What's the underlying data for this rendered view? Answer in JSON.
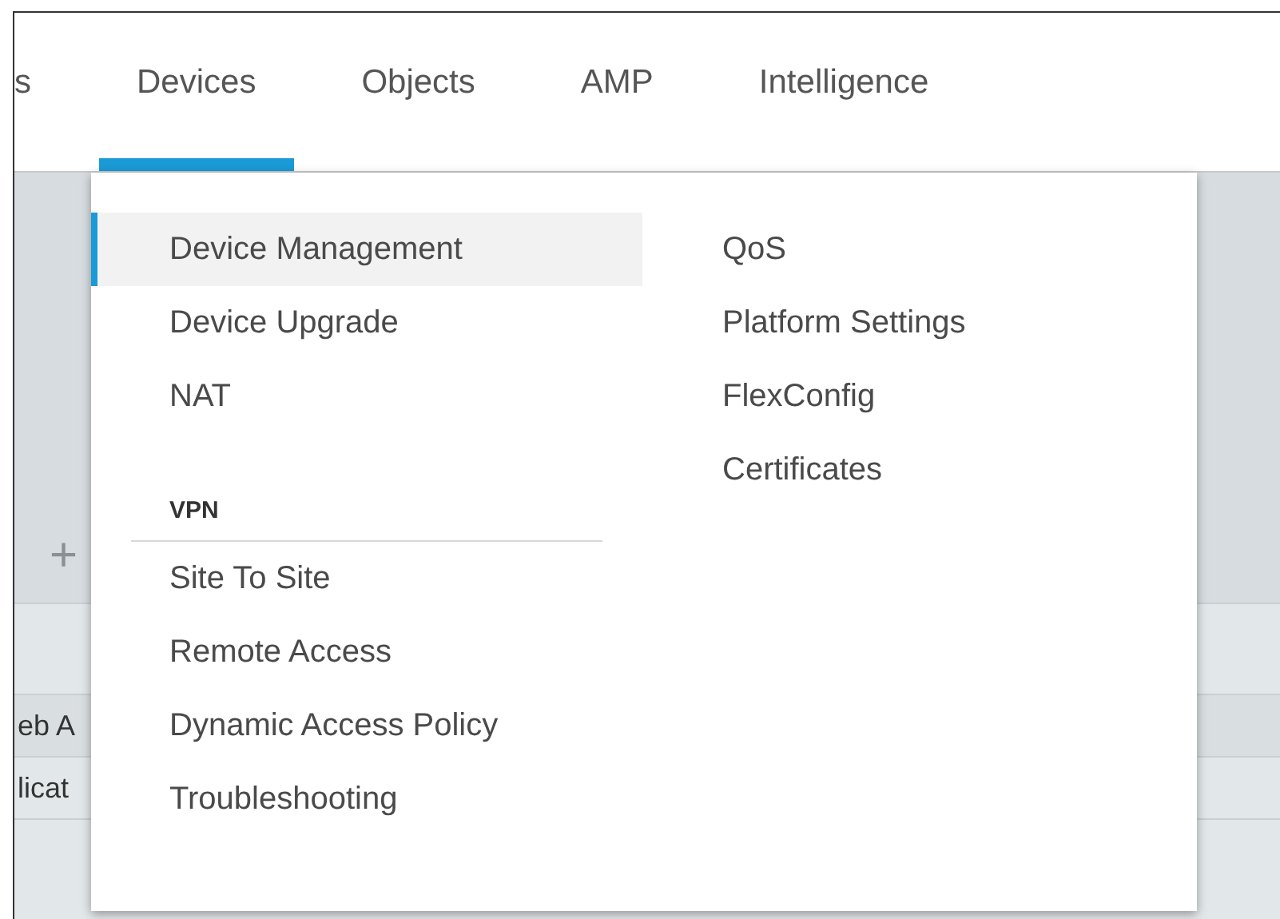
{
  "nav": {
    "tabs": [
      {
        "label": "s",
        "selected": false
      },
      {
        "label": "Devices",
        "selected": true
      },
      {
        "label": "Objects",
        "selected": false
      },
      {
        "label": "AMP",
        "selected": false
      },
      {
        "label": "Intelligence",
        "selected": false
      }
    ]
  },
  "background": {
    "add_icon": "+",
    "rows": [
      "eb A",
      "licat"
    ]
  },
  "menu": {
    "columns": [
      {
        "sections": [
          {
            "items": [
              {
                "label": "Device Management",
                "selected": true
              },
              {
                "label": "Device Upgrade",
                "selected": false
              },
              {
                "label": "NAT",
                "selected": false
              }
            ]
          },
          {
            "header": "VPN",
            "items": [
              {
                "label": "Site To Site",
                "selected": false
              },
              {
                "label": "Remote Access",
                "selected": false
              },
              {
                "label": "Dynamic Access Policy",
                "selected": false
              },
              {
                "label": "Troubleshooting",
                "selected": false
              }
            ]
          }
        ]
      },
      {
        "sections": [
          {
            "items": [
              {
                "label": "QoS",
                "selected": false
              },
              {
                "label": "Platform Settings",
                "selected": false
              },
              {
                "label": "FlexConfig",
                "selected": false
              },
              {
                "label": "Certificates",
                "selected": false
              }
            ]
          }
        ]
      }
    ]
  }
}
